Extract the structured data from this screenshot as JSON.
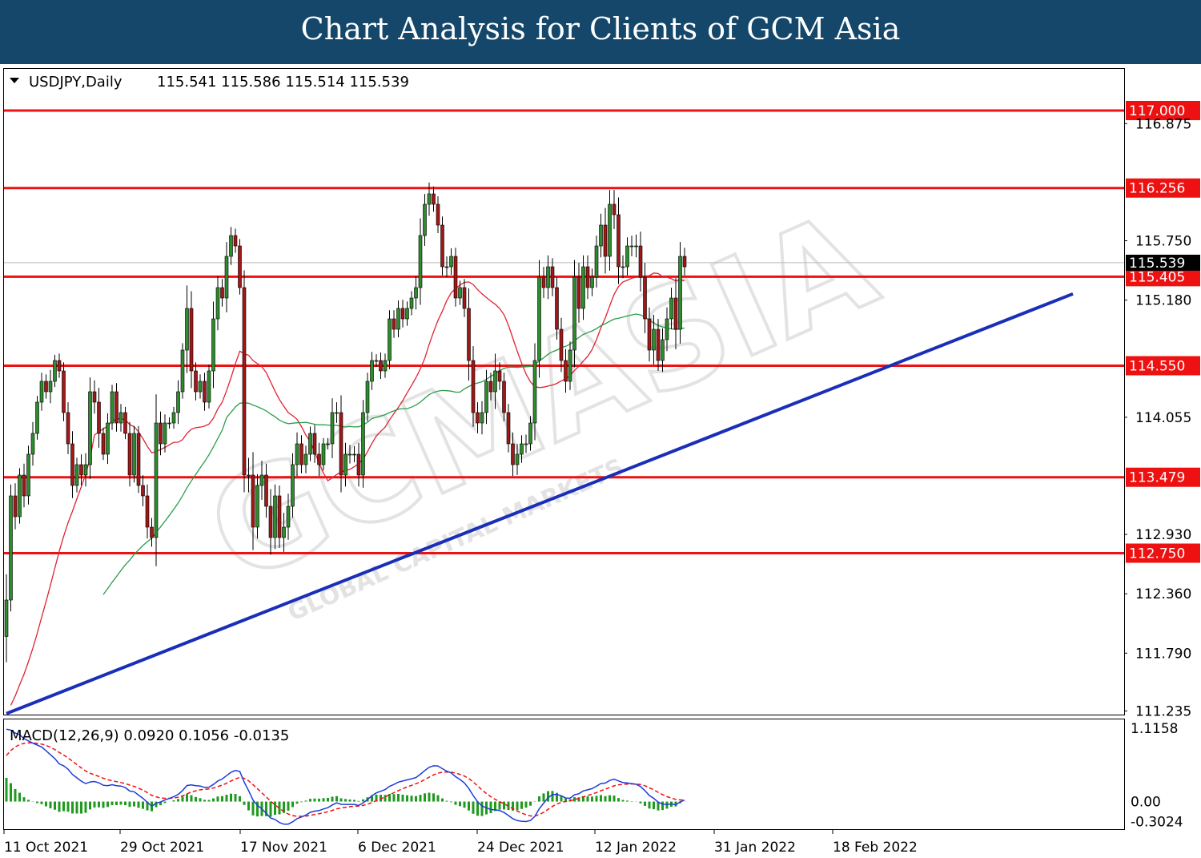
{
  "header": {
    "title": "Chart Analysis for Clients of GCM Asia"
  },
  "watermark": {
    "brand": "GCMASIA",
    "sub": "GLOBAL CAPITAL MARKETS"
  },
  "chart_data": {
    "type": "candlestick",
    "symbol_label": "USDJPY,Daily",
    "ohlc_readout": "115.541 115.586 115.514 115.539",
    "ylim": [
      111.2,
      117.4
    ],
    "y_ticks": [
      "116.875",
      "115.750",
      "115.180",
      "114.055",
      "112.930",
      "112.360",
      "111.790",
      "111.235"
    ],
    "current_price": "115.539",
    "x_labels": [
      "11 Oct 2021",
      "29 Oct 2021",
      "17 Nov 2021",
      "6 Dec 2021",
      "24 Dec 2021",
      "12 Jan 2022",
      "31 Jan 2022",
      "18 Feb 2022"
    ],
    "levels": [
      {
        "label": "117.000",
        "value": 117.0
      },
      {
        "label": "116.256",
        "value": 116.256
      },
      {
        "label": "115.405",
        "value": 115.405
      },
      {
        "label": "114.550",
        "value": 114.55
      },
      {
        "label": "113.479",
        "value": 113.479
      },
      {
        "label": "112.750",
        "value": 112.75
      }
    ],
    "trendline": {
      "start": [
        0,
        111.21
      ],
      "end": [
        182,
        115.24
      ]
    },
    "closes": [
      112.3,
      113.3,
      113.1,
      113.5,
      113.3,
      113.7,
      113.9,
      114.2,
      114.4,
      114.3,
      114.4,
      114.6,
      114.5,
      114.1,
      113.8,
      113.4,
      113.6,
      113.5,
      113.6,
      114.3,
      114.2,
      113.9,
      113.7,
      114.0,
      114.3,
      114.0,
      114.1,
      113.9,
      113.5,
      113.9,
      113.4,
      113.3,
      113.0,
      112.9,
      114.0,
      113.8,
      114.0,
      114.0,
      114.1,
      114.3,
      114.7,
      115.1,
      114.5,
      114.3,
      114.4,
      114.2,
      114.5,
      115.0,
      115.3,
      115.2,
      115.6,
      115.8,
      115.7,
      115.3,
      113.5,
      113.5,
      113.0,
      113.4,
      113.5,
      113.2,
      112.9,
      113.3,
      112.9,
      113.0,
      113.2,
      113.6,
      113.8,
      113.6,
      113.7,
      113.9,
      113.7,
      113.6,
      113.8,
      113.8,
      114.1,
      114.1,
      113.5,
      113.7,
      113.7,
      113.7,
      113.5,
      114.1,
      114.4,
      114.6,
      114.6,
      114.5,
      114.6,
      115.0,
      114.9,
      115.1,
      115.0,
      115.1,
      115.2,
      115.3,
      115.8,
      116.1,
      116.2,
      116.1,
      115.9,
      115.5,
      115.5,
      115.6,
      115.2,
      115.3,
      115.1,
      114.6,
      114.1,
      114.0,
      114.1,
      114.4,
      114.3,
      114.5,
      114.4,
      114.1,
      113.8,
      113.6,
      113.7,
      113.8,
      113.8,
      114.0,
      114.6,
      115.4,
      115.3,
      115.5,
      115.3,
      114.9,
      114.6,
      114.4,
      114.7,
      115.4,
      115.1,
      115.5,
      115.3,
      115.4,
      115.7,
      115.9,
      115.6,
      116.1,
      116.0,
      115.5,
      115.5,
      115.7,
      115.7,
      115.7,
      115.4,
      115.0,
      114.7,
      114.9,
      114.6,
      114.8,
      115.0,
      115.2,
      114.9,
      115.6,
      115.5
    ],
    "volatility": [
      0.45,
      0.2,
      0.22,
      0.12,
      0.2,
      0.15,
      0.2,
      0.11,
      0.15,
      0.12,
      0.2,
      0.1,
      0.12,
      0.15,
      0.18,
      0.22,
      0.12,
      0.18,
      0.2,
      0.25,
      0.2,
      0.25,
      0.1,
      0.17,
      0.12,
      0.15,
      0.15,
      0.1,
      0.2,
      0.13,
      0.13,
      0.18,
      0.2,
      0.16,
      0.5,
      0.2,
      0.15,
      0.1,
      0.1,
      0.2,
      0.12,
      0.4,
      0.3,
      0.15,
      0.12,
      0.15,
      0.11,
      0.3,
      0.2,
      0.15,
      0.25,
      0.15,
      0.12,
      0.12,
      0.3,
      0.3,
      0.4,
      0.2,
      0.25,
      0.2,
      0.3,
      0.2,
      0.18,
      0.25,
      0.22,
      0.2,
      0.2,
      0.15,
      0.15,
      0.12,
      0.15,
      0.2,
      0.1,
      0.1,
      0.25,
      0.18,
      0.3,
      0.2,
      0.16,
      0.14,
      0.2,
      0.22,
      0.15,
      0.15,
      0.11,
      0.14,
      0.12,
      0.15,
      0.15,
      0.14,
      0.15,
      0.12,
      0.12,
      0.2,
      0.3,
      0.18,
      0.2,
      0.13,
      0.14,
      0.15,
      0.18,
      0.14,
      0.15,
      0.12,
      0.15,
      0.35,
      0.25,
      0.18,
      0.2,
      0.2,
      0.15,
      0.3,
      0.15,
      0.15,
      0.15,
      0.2,
      0.18,
      0.15,
      0.16,
      0.12,
      0.3,
      0.3,
      0.18,
      0.2,
      0.15,
      0.18,
      0.2,
      0.2,
      0.15,
      0.3,
      0.25,
      0.2,
      0.2,
      0.15,
      0.18,
      0.2,
      0.3,
      0.25,
      0.25,
      0.3,
      0.2,
      0.15,
      0.18,
      0.2,
      0.25,
      0.25,
      0.2,
      0.25,
      0.18,
      0.2,
      0.2,
      0.18,
      0.35,
      0.25,
      0.15
    ],
    "ma_fast": {
      "color": "#e02233"
    },
    "ma_slow": {
      "color": "#2a9d4a"
    },
    "candle_up_color": "#2e8b2e",
    "candle_down_color": "#a01818",
    "level_color": "#ee1111",
    "trend_color": "#1a2fb8",
    "macd": {
      "label": "MACD(12,26,9) 0.0920 0.1056 -0.0135",
      "ylim": [
        -0.42,
        1.25
      ],
      "y_ticks": [
        "1.1158",
        "0.00",
        "-0.3024"
      ],
      "macd_color": "#1f3cd8",
      "signal_color": "#ee1111",
      "hist_color": "#1f9a1f"
    }
  }
}
